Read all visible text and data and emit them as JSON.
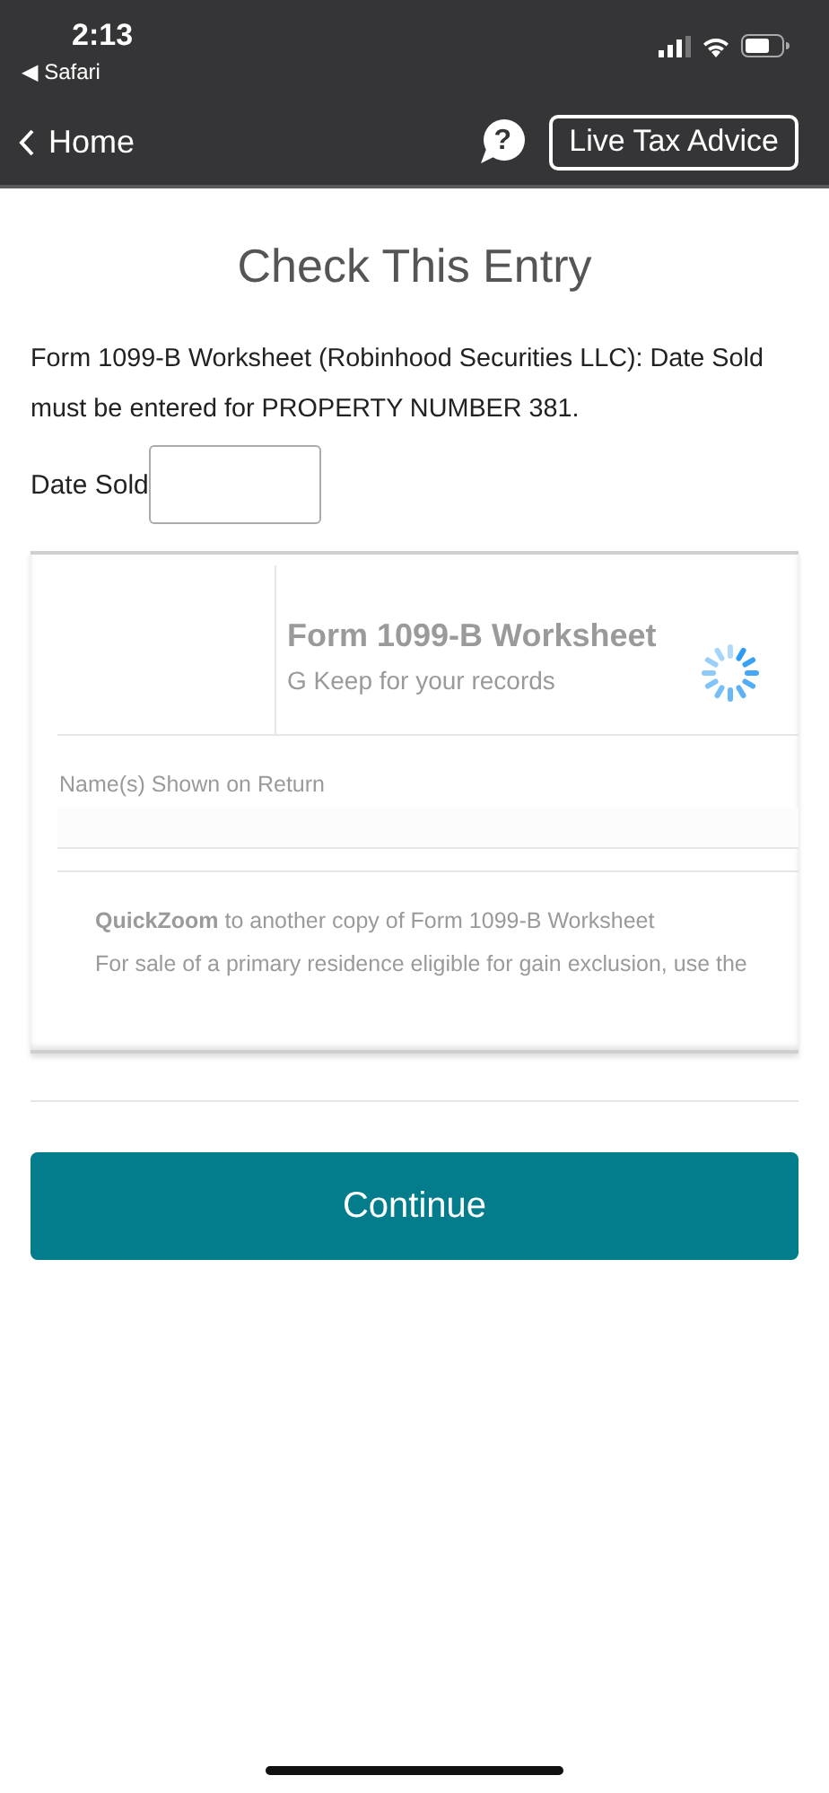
{
  "status_bar": {
    "time": "2:13",
    "back_app": "◀ Safari"
  },
  "nav": {
    "back_label": "Home",
    "help": "?",
    "advice_button": "Live Tax Advice"
  },
  "title": "Check This Entry",
  "message": "Form 1099-B Worksheet (Robinhood Securities LLC): Date Sold must be entered for PROPERTY NUMBER 381.",
  "date_sold": {
    "label": "Date Sold"
  },
  "worksheet_preview": {
    "title": "Form 1099-B Worksheet",
    "subtitle": "G Keep for your records",
    "name_label": "Name(s) Shown on Return",
    "quickzoom": "**QuickZoom** to another copy of Form 1099-B Worksheet",
    "note": "For sale of a primary residence eligible for gain exclusion, use the"
  },
  "continue_button": "Continue"
}
